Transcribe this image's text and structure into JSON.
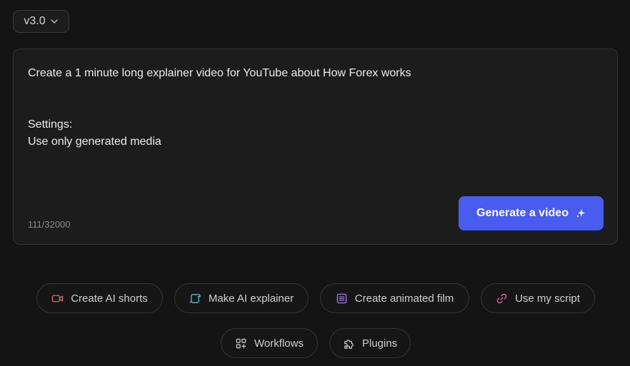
{
  "version_select": {
    "value": "v3.0",
    "icon": "chevron-down-icon"
  },
  "prompt": {
    "text": "Create a 1 minute long explainer video for YouTube about How Forex works\n\n\nSettings:\nUse only generated media",
    "char_count": "111/32000"
  },
  "generate_button": {
    "label": "Generate a video",
    "icon": "sparkle-icon",
    "color": "#4a5cf0"
  },
  "actions": [
    {
      "label": "Create AI shorts",
      "icon": "video-camera-icon",
      "icon_color": "#e46b6b"
    },
    {
      "label": "Make AI explainer",
      "icon": "scroll-icon",
      "icon_color": "#5bb8c8"
    },
    {
      "label": "Create animated film",
      "icon": "document-icon",
      "icon_color": "#9b7be0"
    },
    {
      "label": "Use my script",
      "icon": "link-icon",
      "icon_color": "#e36aa6"
    },
    {
      "label": "Workflows",
      "icon": "grid-plus-icon",
      "icon_color": "#cfcfcf"
    },
    {
      "label": "Plugins",
      "icon": "puzzle-icon",
      "icon_color": "#cfcfcf"
    }
  ]
}
